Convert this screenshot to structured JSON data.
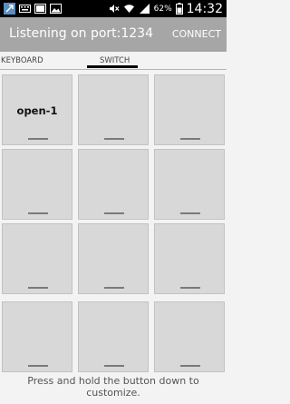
{
  "status_bar": {
    "battery_percent": "62%",
    "time": "14:32"
  },
  "header": {
    "title": "Listening on port:1234",
    "connect_label": "CONNECT"
  },
  "tabs": [
    {
      "label": "KEYBOARD",
      "selected": false
    },
    {
      "label": "SWITCH",
      "selected": true
    }
  ],
  "grid": {
    "buttons": [
      "open-1",
      "",
      "",
      "",
      "",
      "",
      "",
      "",
      "",
      "",
      "",
      ""
    ]
  },
  "footer": {
    "hint": "Press and hold the button down to customize."
  }
}
